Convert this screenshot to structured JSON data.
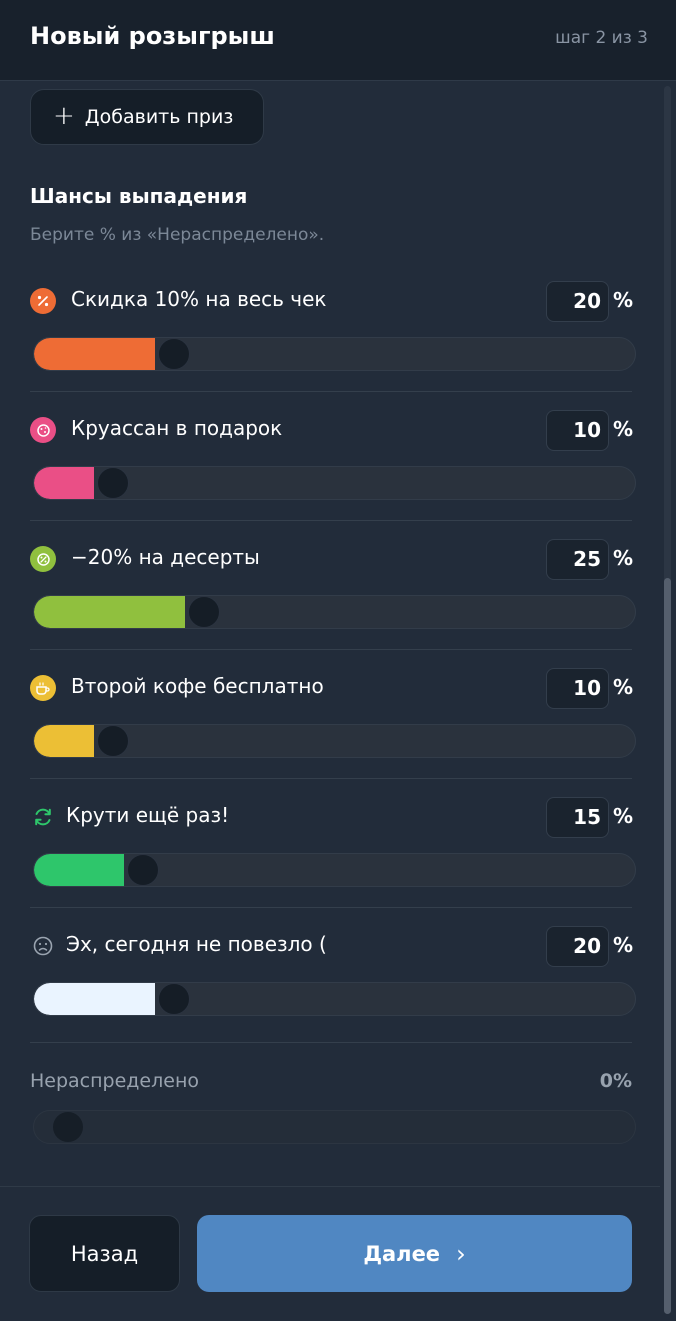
{
  "header": {
    "title": "Новый розыгрыш",
    "step": "шаг 2 из 3"
  },
  "add_prize": {
    "label": "Добавить приз"
  },
  "odds": {
    "title": "Шансы выпадения",
    "hint": "Берите % из «Нераспределено»."
  },
  "prizes": [
    {
      "name": "Скидка 10% на весь чек",
      "value": "20",
      "unit": "%",
      "icon": "percent-icon",
      "color": "#ee6c35",
      "fraction": 0.2
    },
    {
      "name": "Круассан в подарок",
      "value": "10",
      "unit": "%",
      "icon": "cookie-icon",
      "color": "#ea4f86",
      "fraction": 0.1
    },
    {
      "name": "−20% на десерты",
      "value": "25",
      "unit": "%",
      "icon": "discount-badge-icon",
      "color": "#90c03e",
      "fraction": 0.25
    },
    {
      "name": "Второй кофе бесплатно",
      "value": "10",
      "unit": "%",
      "icon": "coffee-icon",
      "color": "#ecbf35",
      "fraction": 0.1
    },
    {
      "name": "Крути ещё раз!",
      "value": "15",
      "unit": "%",
      "icon": "refresh-icon",
      "color": "#2ec66b",
      "fraction": 0.15
    },
    {
      "name": "Эх, сегодня не повезло (",
      "value": "20",
      "unit": "%",
      "icon": "sad-face-icon",
      "color": "#eaf4ff",
      "fraction": 0.2
    }
  ],
  "unassigned": {
    "label": "Нераспределено",
    "value": "0%"
  },
  "footer": {
    "back_label": "Назад",
    "next_label": "Далее"
  }
}
